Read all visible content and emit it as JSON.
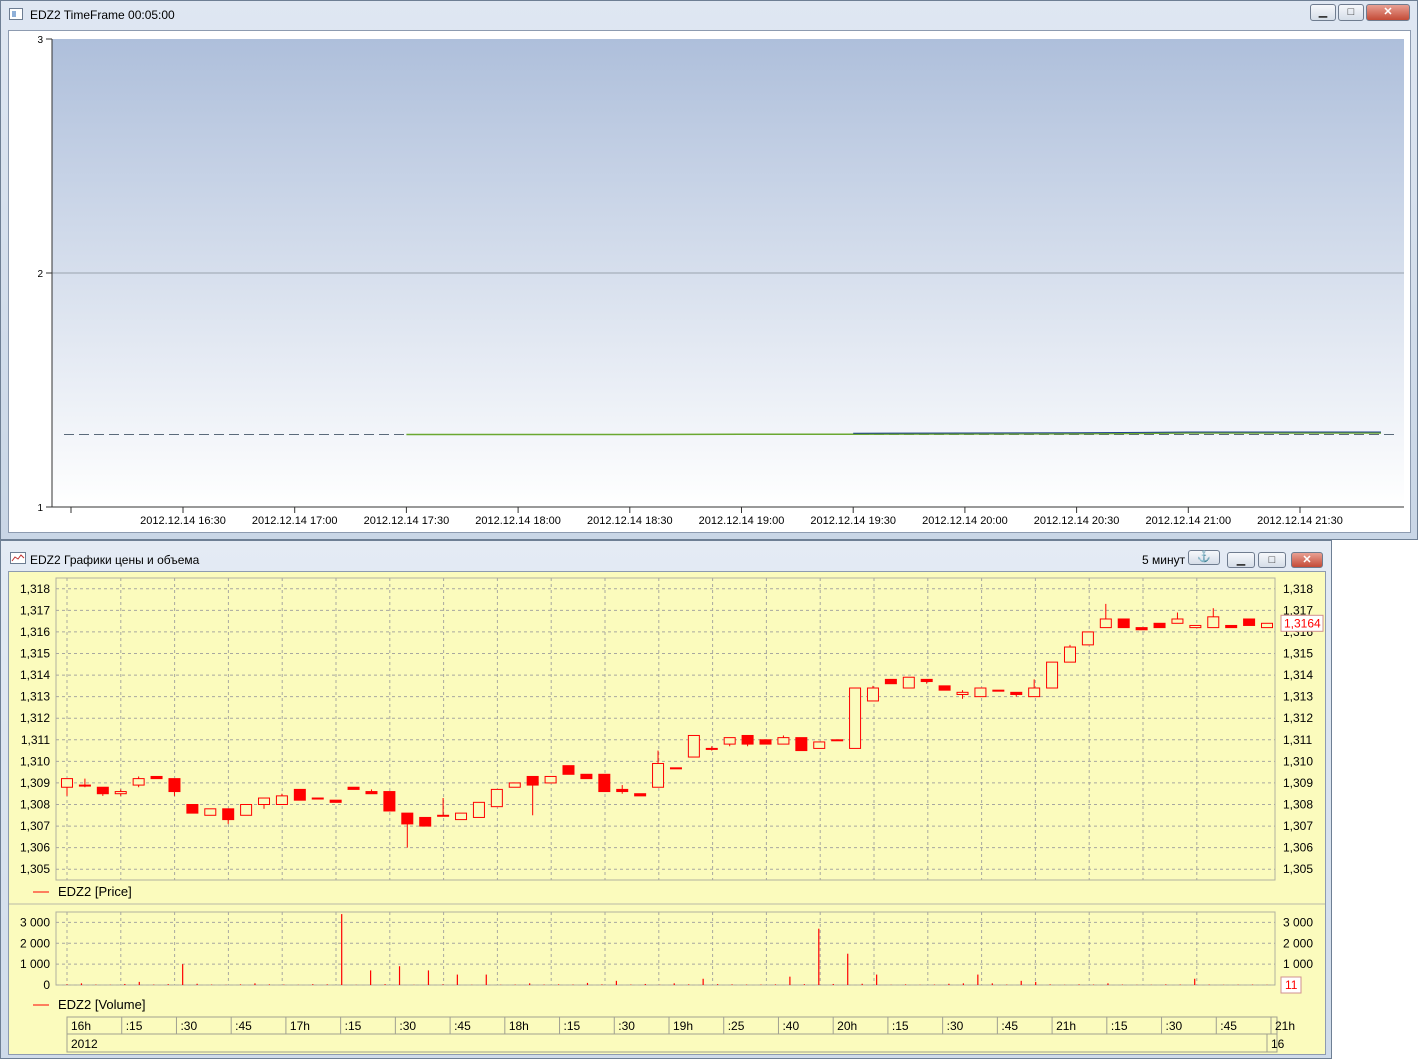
{
  "window_top": {
    "title": "EDZ2 TimeFrame 00:05:00",
    "buttons": {
      "minimize": "▁",
      "maximize": "□",
      "close": "✕"
    },
    "y_ticks": [
      "3",
      "2",
      "1"
    ],
    "x_ticks": [
      "2012.12.14 16:30",
      "2012.12.14 17:00",
      "2012.12.14 17:30",
      "2012.12.14 18:00",
      "2012.12.14 18:30",
      "2012.12.14 19:00",
      "2012.12.14 19:30",
      "2012.12.14 20:00",
      "2012.12.14 20:30",
      "2012.12.14 21:00",
      "2012.12.14 21:30"
    ],
    "background_gradient": [
      "#aebfdb",
      "#ffffff"
    ],
    "line_colors": {
      "dashed": "#5a6a7a",
      "green": "#6aa830",
      "blue": "#1f3f8f"
    }
  },
  "window_bottom": {
    "title": "EDZ2 Графики цены и объема",
    "interval": "5 минут",
    "buttons": {
      "anchor": "⚓",
      "minimize": "▁",
      "maximize": "□",
      "close": "✕"
    },
    "price_panel": {
      "legend": "EDZ2 [Price]",
      "y_ticks": [
        "1,318",
        "1,317",
        "1,316",
        "1,315",
        "1,314",
        "1,313",
        "1,312",
        "1,311",
        "1,310",
        "1,309",
        "1,308",
        "1,307",
        "1,306",
        "1,305"
      ],
      "last_price": "1,3164"
    },
    "volume_panel": {
      "legend": "EDZ2 [Volume]",
      "y_ticks": [
        "3 000",
        "2 000",
        "1 000",
        "0"
      ],
      "last_volume": "11"
    },
    "time_axis": {
      "labels": [
        "16h",
        ":15",
        ":30",
        ":45",
        "17h",
        ":15",
        ":30",
        ":45",
        "18h",
        ":15",
        ":30",
        "19h",
        ":25",
        ":40",
        "20h",
        ":15",
        ":30",
        ":45",
        "21h",
        ":15",
        ":30",
        ":45",
        "21h"
      ],
      "year": "2012",
      "day": "16"
    },
    "colors": {
      "panel_bg": "#fbfbbd",
      "candle": "#ff0000",
      "grid": "#a8a8a0"
    }
  },
  "chart_data": [
    {
      "type": "line",
      "title": "",
      "xlabel": "",
      "ylabel": "",
      "x": [
        "2012.12.14 16:30",
        "2012.12.14 17:00",
        "2012.12.14 17:30",
        "2012.12.14 18:00",
        "2012.12.14 18:30",
        "2012.12.14 19:00",
        "2012.12.14 19:30",
        "2012.12.14 20:00",
        "2012.12.14 20:30",
        "2012.12.14 21:00",
        "2012.12.14 21:30"
      ],
      "ylim": [
        1,
        3
      ],
      "series": [
        {
          "style": "dashed",
          "values": [
            1.31,
            1.31,
            1.31,
            1.31,
            1.31,
            1.31,
            1.31,
            1.31,
            1.31,
            1.31,
            1.31
          ]
        },
        {
          "style": "solid",
          "values": [
            null,
            null,
            1.31,
            1.31,
            1.31,
            1.311,
            1.311,
            1.312,
            1.313,
            1.316,
            1.316
          ]
        }
      ],
      "grid": true
    },
    {
      "type": "candlestick",
      "ylim": [
        1.3045,
        1.3185
      ],
      "candles": [
        [
          1.3088,
          1.3092,
          1.3084,
          1.3092
        ],
        [
          1.3089,
          1.3092,
          1.3088,
          1.3089
        ],
        [
          1.3088,
          1.3088,
          1.3084,
          1.3085
        ],
        [
          1.3085,
          1.3087,
          1.3084,
          1.3086
        ],
        [
          1.3089,
          1.3093,
          1.3088,
          1.3092
        ],
        [
          1.3093,
          1.3093,
          1.3092,
          1.3092
        ],
        [
          1.3092,
          1.3092,
          1.3084,
          1.3086
        ],
        [
          1.308,
          1.308,
          1.3076,
          1.3076
        ],
        [
          1.3075,
          1.3078,
          1.3075,
          1.3078
        ],
        [
          1.3078,
          1.3078,
          1.3071,
          1.3073
        ],
        [
          1.3075,
          1.308,
          1.3075,
          1.308
        ],
        [
          1.308,
          1.3083,
          1.3078,
          1.3083
        ],
        [
          1.308,
          1.3085,
          1.308,
          1.3084
        ],
        [
          1.3087,
          1.3087,
          1.3082,
          1.3082
        ],
        [
          1.3083,
          1.3083,
          1.3083,
          1.3083
        ],
        [
          1.3082,
          1.3082,
          1.3081,
          1.3081
        ],
        [
          1.3088,
          1.3088,
          1.3087,
          1.3087
        ],
        [
          1.3086,
          1.3087,
          1.3085,
          1.3085
        ],
        [
          1.3086,
          1.3086,
          1.3077,
          1.3077
        ],
        [
          1.3076,
          1.3076,
          1.306,
          1.3071
        ],
        [
          1.3074,
          1.3074,
          1.307,
          1.307
        ],
        [
          1.3075,
          1.3083,
          1.3075,
          1.3075
        ],
        [
          1.3073,
          1.3076,
          1.3073,
          1.3076
        ],
        [
          1.3074,
          1.3081,
          1.3074,
          1.3081
        ],
        [
          1.3079,
          1.3087,
          1.3079,
          1.3087
        ],
        [
          1.3088,
          1.309,
          1.3088,
          1.309
        ],
        [
          1.3093,
          1.3093,
          1.3075,
          1.3089
        ],
        [
          1.309,
          1.3093,
          1.309,
          1.3093
        ],
        [
          1.3098,
          1.3098,
          1.3094,
          1.3094
        ],
        [
          1.3094,
          1.3094,
          1.3092,
          1.3092
        ],
        [
          1.3094,
          1.3094,
          1.3086,
          1.3086
        ],
        [
          1.3087,
          1.3089,
          1.3085,
          1.3086
        ],
        [
          1.3085,
          1.3085,
          1.3084,
          1.3084
        ],
        [
          1.3088,
          1.3105,
          1.3088,
          1.3099
        ],
        [
          1.3097,
          1.3097,
          1.3097,
          1.3097
        ],
        [
          1.3102,
          1.3112,
          1.3102,
          1.3112
        ],
        [
          1.3106,
          1.3107,
          1.3105,
          1.3106
        ],
        [
          1.3108,
          1.3111,
          1.3107,
          1.3111
        ],
        [
          1.3112,
          1.3112,
          1.3107,
          1.3108
        ],
        [
          1.311,
          1.311,
          1.3108,
          1.3108
        ],
        [
          1.3108,
          1.3112,
          1.3108,
          1.3111
        ],
        [
          1.3111,
          1.3111,
          1.3105,
          1.3105
        ],
        [
          1.3106,
          1.3109,
          1.3106,
          1.3109
        ],
        [
          1.311,
          1.311,
          1.311,
          1.311
        ],
        [
          1.3106,
          1.3134,
          1.3106,
          1.3134
        ],
        [
          1.3128,
          1.3135,
          1.3128,
          1.3134
        ],
        [
          1.3138,
          1.3138,
          1.3136,
          1.3136
        ],
        [
          1.3134,
          1.3139,
          1.3134,
          1.3139
        ],
        [
          1.3138,
          1.3138,
          1.3136,
          1.3137
        ],
        [
          1.3135,
          1.3135,
          1.3133,
          1.3133
        ],
        [
          1.3131,
          1.3133,
          1.3129,
          1.3132
        ],
        [
          1.313,
          1.3134,
          1.313,
          1.3134
        ],
        [
          1.3133,
          1.3133,
          1.3133,
          1.3133
        ],
        [
          1.3132,
          1.3132,
          1.313,
          1.3131
        ],
        [
          1.313,
          1.3138,
          1.313,
          1.3134
        ],
        [
          1.3134,
          1.3146,
          1.3134,
          1.3146
        ],
        [
          1.3146,
          1.3154,
          1.3146,
          1.3153
        ],
        [
          1.3154,
          1.316,
          1.3154,
          1.316
        ],
        [
          1.3162,
          1.3173,
          1.3162,
          1.3166
        ],
        [
          1.3166,
          1.3166,
          1.3162,
          1.3162
        ],
        [
          1.3162,
          1.3162,
          1.3161,
          1.3161
        ],
        [
          1.3164,
          1.3164,
          1.3162,
          1.3162
        ],
        [
          1.3164,
          1.3169,
          1.3164,
          1.3166
        ],
        [
          1.3162,
          1.3162,
          1.3162,
          1.3163
        ],
        [
          1.3162,
          1.3171,
          1.3162,
          1.3167
        ],
        [
          1.3163,
          1.3163,
          1.3162,
          1.3162
        ],
        [
          1.3166,
          1.3166,
          1.3163,
          1.3163
        ],
        [
          1.3162,
          1.3164,
          1.3162,
          1.3164
        ]
      ]
    },
    {
      "type": "bar",
      "ylim": [
        0,
        3500
      ],
      "values": [
        30,
        80,
        20,
        10,
        50,
        150,
        20,
        40,
        1000,
        60,
        20,
        10,
        30,
        80,
        30,
        20,
        10,
        40,
        30,
        3400,
        10,
        700,
        40,
        900,
        10,
        700,
        30,
        500,
        10,
        500,
        10,
        20,
        80,
        20,
        30,
        20,
        100,
        30,
        200,
        20,
        50,
        10,
        80,
        30,
        300,
        40,
        30,
        20,
        20,
        30,
        400,
        40,
        2700,
        50,
        1500,
        60,
        500,
        10,
        30,
        10,
        20,
        60,
        80,
        500,
        80,
        20,
        200,
        150,
        30,
        10,
        30,
        20,
        80,
        20,
        10,
        10,
        30,
        20,
        300,
        20,
        10,
        15,
        20,
        11
      ]
    }
  ]
}
